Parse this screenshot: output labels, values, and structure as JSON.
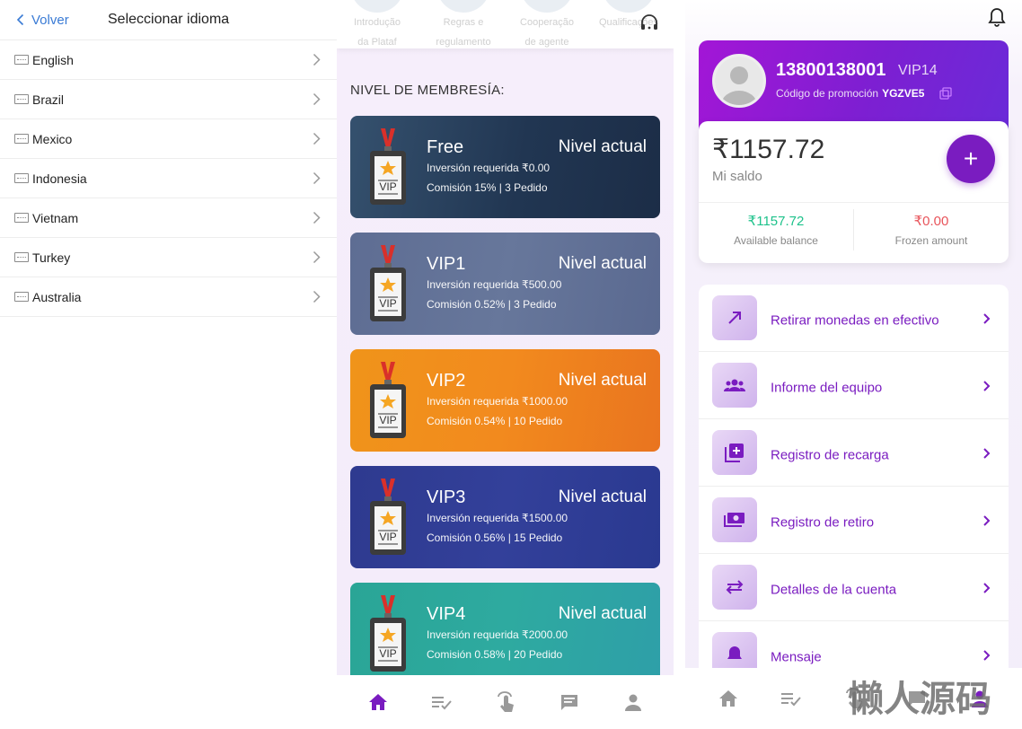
{
  "left": {
    "back_label": "Volver",
    "title": "Seleccionar idioma",
    "languages": [
      "English",
      "Brazil",
      "Mexico",
      "Indonesia",
      "Vietnam",
      "Turkey",
      "Australia"
    ]
  },
  "middle": {
    "top_items": [
      "Introdução da Plataf",
      "Regras e regulamento",
      "Cooperação de agente",
      "Qualificações"
    ],
    "section_title": "NIVEL DE MEMBRESÍA:",
    "cards": [
      {
        "name": "Free",
        "level": "Nivel actual",
        "req": "Inversión requerida ₹0.00",
        "com": "Comisión 15% | 3 Pedido"
      },
      {
        "name": "VIP1",
        "level": "Nivel actual",
        "req": "Inversión requerida ₹500.00",
        "com": "Comisión 0.52% | 3 Pedido"
      },
      {
        "name": "VIP2",
        "level": "Nivel actual",
        "req": "Inversión requerida ₹1000.00",
        "com": "Comisión 0.54% | 10 Pedido"
      },
      {
        "name": "VIP3",
        "level": "Nivel actual",
        "req": "Inversión requerida ₹1500.00",
        "com": "Comisión 0.56% | 15 Pedido"
      },
      {
        "name": "VIP4",
        "level": "Nivel actual",
        "req": "Inversión requerida ₹2000.00",
        "com": "Comisión 0.58% | 20 Pedido"
      }
    ],
    "badge_text": "VIP",
    "nav_icons": [
      "home-icon",
      "tasks-icon",
      "tap-icon",
      "chat-icon",
      "user-icon"
    ]
  },
  "right": {
    "phone": "13800138001",
    "vip_level": "VIP14",
    "promo_label": "Código de promoción",
    "promo_code": "YGZVE5",
    "balance": "₹1157.72",
    "balance_label": "Mi saldo",
    "available_value": "₹1157.72",
    "available_label": "Available balance",
    "frozen_value": "₹0.00",
    "frozen_label": "Frozen amount",
    "menu": [
      {
        "label": "Retirar monedas en efectivo",
        "icon": "arrow-up-right-icon"
      },
      {
        "label": "Informe del equipo",
        "icon": "team-icon"
      },
      {
        "label": "Registro de recarga",
        "icon": "add-box-icon"
      },
      {
        "label": "Registro de retiro",
        "icon": "cash-icon"
      },
      {
        "label": "Detalles de la cuenta",
        "icon": "swap-icon"
      },
      {
        "label": "Mensaje",
        "icon": "bell-icon"
      }
    ],
    "watermark": "懒人源码"
  },
  "colors": {
    "accent": "#7a1cc0",
    "green": "#1ec28b",
    "red": "#e8545b",
    "link_blue": "#3a7bd5"
  }
}
